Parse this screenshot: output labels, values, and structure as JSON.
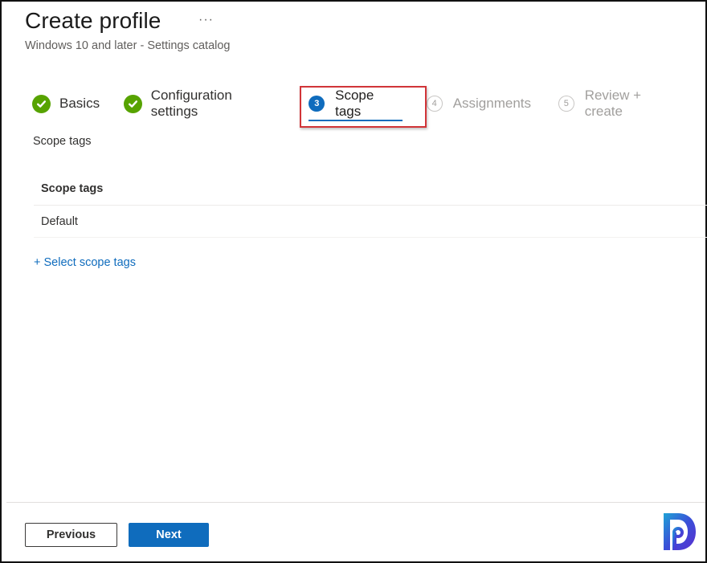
{
  "header": {
    "title": "Create profile",
    "more_label": "···",
    "subtitle": "Windows 10 and later - Settings catalog"
  },
  "wizard": {
    "steps": [
      {
        "label": "Basics",
        "state": "completed",
        "icon": "check-circle-icon"
      },
      {
        "label": "Configuration settings",
        "state": "completed",
        "icon": "check-circle-icon"
      },
      {
        "label": "Scope tags",
        "state": "active",
        "number": "3"
      },
      {
        "label": "Assignments",
        "state": "disabled",
        "number": "4"
      },
      {
        "label": "Review + create",
        "state": "disabled",
        "number": "5"
      }
    ]
  },
  "main": {
    "section_label": "Scope tags",
    "table": {
      "header": "Scope tags",
      "rows": [
        "Default"
      ]
    },
    "add_link": "+ Select scope tags"
  },
  "footer": {
    "previous_label": "Previous",
    "next_label": "Next"
  },
  "colors": {
    "accent": "#0f6cbd",
    "success": "#57a300",
    "highlight": "#d13438"
  }
}
